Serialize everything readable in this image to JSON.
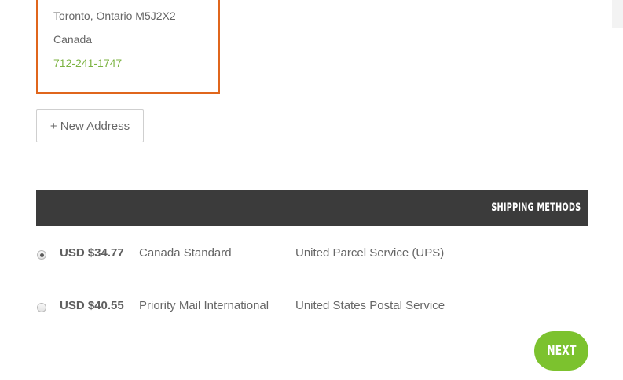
{
  "address": {
    "city_line": "Toronto, Ontario M5J2X2",
    "country": "Canada",
    "phone": "712-241-1747"
  },
  "new_address_label": "+ New Address",
  "shipping": {
    "title": "SHIPPING METHODS",
    "methods": [
      {
        "price": "USD $34.77",
        "service": "Canada Standard",
        "carrier": "United Parcel Service (UPS)",
        "selected": true
      },
      {
        "price": "USD $40.55",
        "service": "Priority Mail International",
        "carrier": "United States Postal Service",
        "selected": false
      }
    ]
  },
  "next_label": "NEXT",
  "colors": {
    "card_border": "#e0661c",
    "link": "#7cb342",
    "header_bg": "#3b3b3b",
    "next_button": "#7cc22e"
  }
}
